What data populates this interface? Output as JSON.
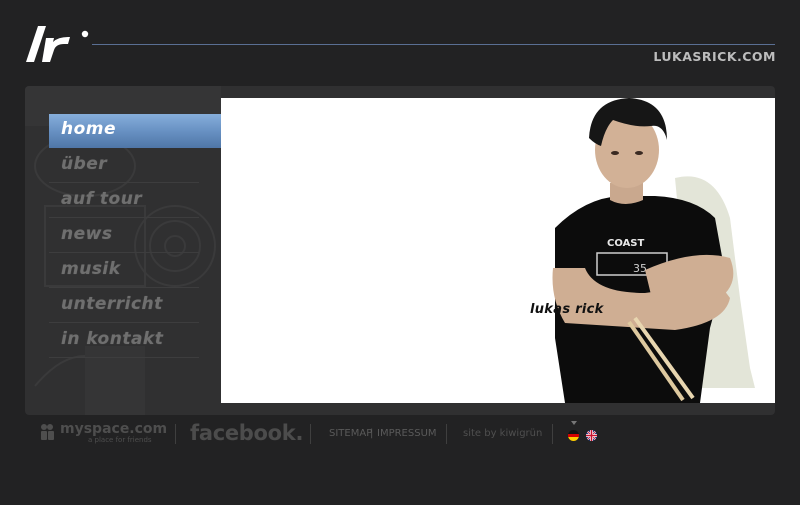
{
  "header": {
    "logo_text": "lr",
    "domain": "LUKASRICK.COM"
  },
  "nav": {
    "items": [
      {
        "label": "home",
        "active": true
      },
      {
        "label": "über",
        "active": false
      },
      {
        "label": "auf tour",
        "active": false
      },
      {
        "label": "news",
        "active": false
      },
      {
        "label": "musik",
        "active": false
      },
      {
        "label": "unterricht",
        "active": false
      },
      {
        "label": "in kontakt",
        "active": false
      }
    ]
  },
  "content": {
    "name_tag": "lukas rick",
    "shirt_text": "COAST"
  },
  "footer": {
    "myspace": "myspace.com",
    "myspace_tagline": "a place for friends",
    "facebook": "facebook.",
    "sitemap": "SITEMAP",
    "separator": "|",
    "impressum": "IMPRESSUM",
    "credit": "site by kiwigrün",
    "languages": [
      "de",
      "en"
    ]
  },
  "colors": {
    "background": "#222223",
    "panel": "#303031",
    "accent": "#5a83b4",
    "rule": "#5a6f93"
  }
}
